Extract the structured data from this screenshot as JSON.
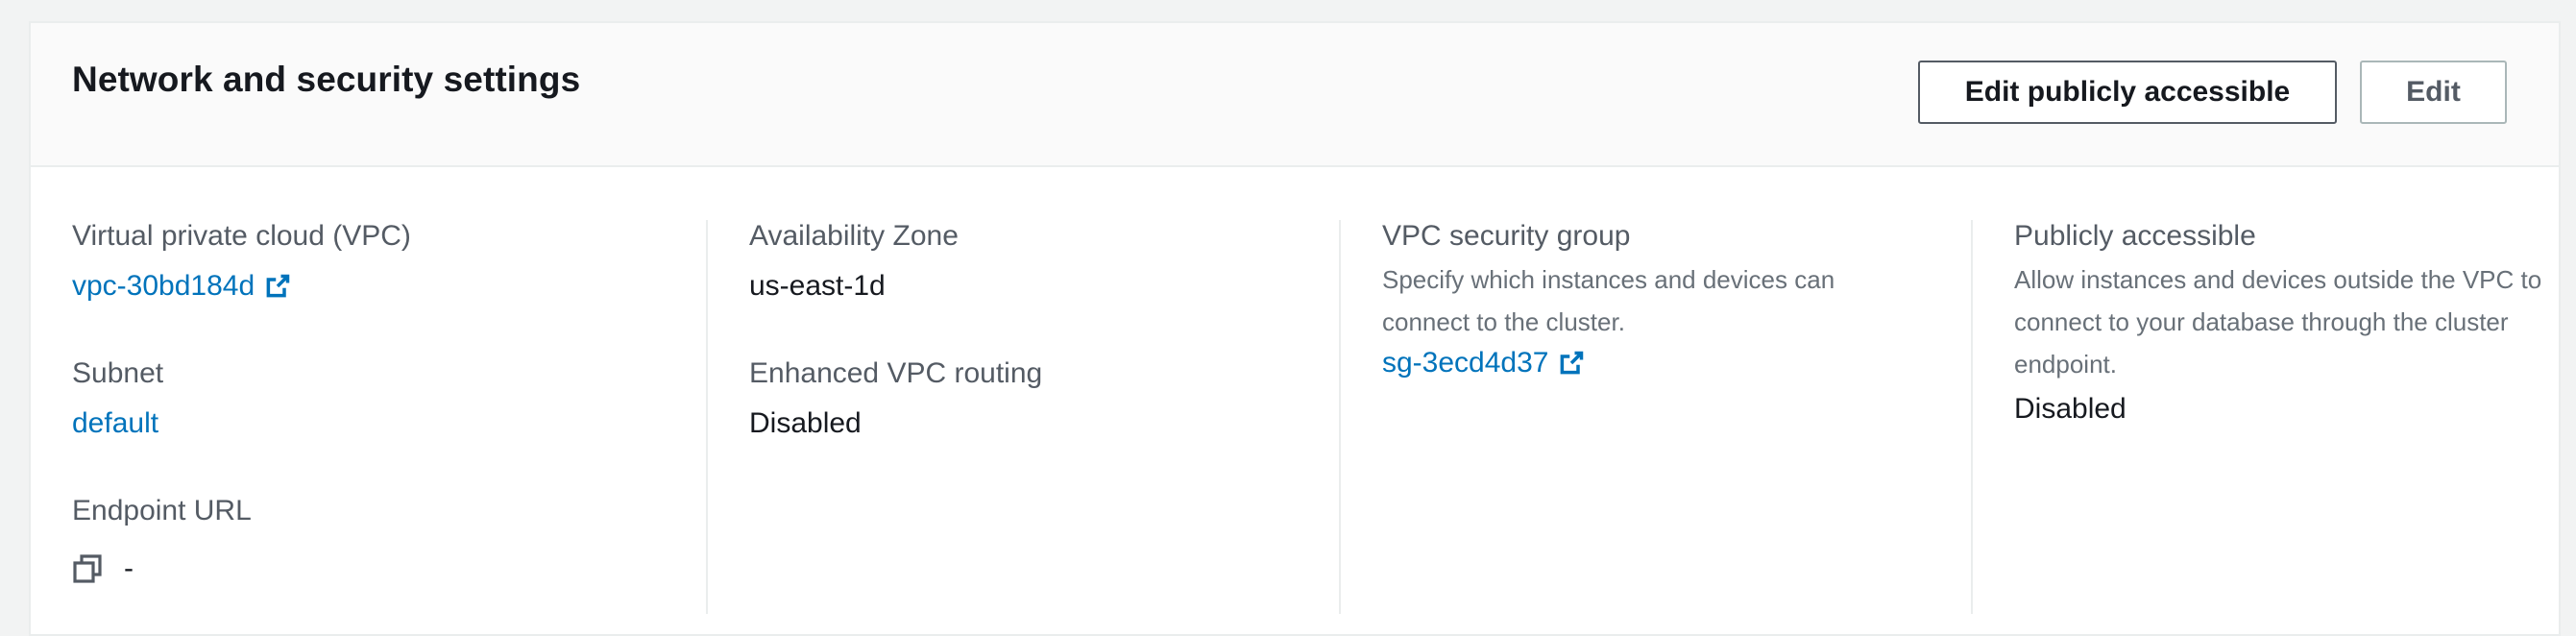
{
  "section": {
    "title": "Network and security settings",
    "buttons": {
      "edit_publicly_accessible": "Edit publicly accessible",
      "edit": "Edit"
    }
  },
  "columns": {
    "col1": {
      "vpc_label": "Virtual private cloud (VPC)",
      "vpc_value": "vpc-30bd184d",
      "subnet_label": "Subnet",
      "subnet_value": "default",
      "endpoint_label": "Endpoint URL",
      "endpoint_value": "-"
    },
    "col2": {
      "az_label": "Availability Zone",
      "az_value": "us-east-1d",
      "routing_label": "Enhanced VPC routing",
      "routing_value": "Disabled"
    },
    "col3": {
      "sg_label": "VPC security group",
      "sg_description": "Specify which instances and devices can connect to the cluster.",
      "sg_value": "sg-3ecd4d37"
    },
    "col4": {
      "pa_label": "Publicly accessible",
      "pa_description": "Allow instances and devices outside the VPC to connect to your database through the cluster endpoint.",
      "pa_value": "Disabled"
    }
  },
  "icons": {
    "external_link": "external-link-icon",
    "copy": "copy-icon"
  },
  "colors": {
    "link": "#0073bb",
    "text": "#16191f",
    "label": "#545b64",
    "description": "#687078",
    "border": "#eaeded"
  }
}
